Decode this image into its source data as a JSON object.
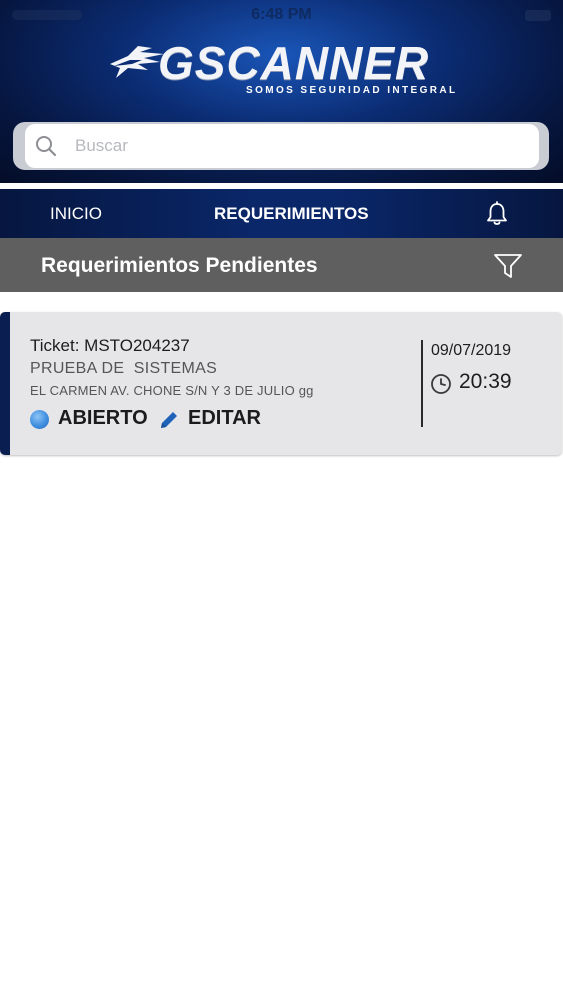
{
  "status_bar": {
    "time": "6:48 PM"
  },
  "header": {
    "logo_text": "GSCANNER",
    "tagline": "SOMOS SEGURIDAD INTEGRAL"
  },
  "search": {
    "placeholder": "Buscar",
    "value": ""
  },
  "nav": {
    "items": [
      {
        "label": "INICIO",
        "active": false
      },
      {
        "label": "REQUERIMIENTOS",
        "active": true
      }
    ],
    "notification_icon": "bell-icon"
  },
  "section": {
    "title": "Requerimientos Pendientes",
    "filter_icon": "filter-icon"
  },
  "tickets": [
    {
      "ticket": "Ticket: MSTO204237",
      "title": "PRUEBA DE  SISTEMAS",
      "address": "EL CARMEN AV. CHONE S/N Y 3 DE JULIO gg",
      "status": "ABIERTO",
      "status_color": "#3f8fe0",
      "edit_label": "EDITAR",
      "date": "09/07/2019",
      "time": "20:39"
    }
  ],
  "colors": {
    "header_dark": "#06163f",
    "header_accent": "#1a56b8",
    "section_bar": "#5f5f5f",
    "card_bg": "#e6e6e9",
    "card_accent": "#0b1e52",
    "edit_icon": "#1f63b8"
  }
}
